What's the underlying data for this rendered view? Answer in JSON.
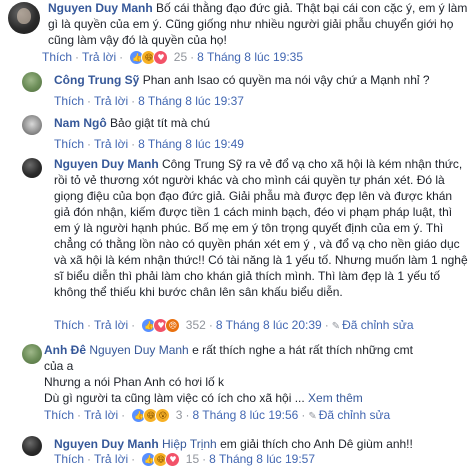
{
  "labels": {
    "reply": "Thích",
    "answer": "Trả lời",
    "edit_label": "Đã chỉnh sửa",
    "see_more": "Xem thêm",
    "sep": "·"
  },
  "comments": [
    {
      "author": "Nguyen Duy Manh",
      "text_first": "Bố cái thằng đạo đức giả. Thật bại cái con cặc ý, em",
      "text_rest": "ý làm gì là quyền của em ý. Cũng giống như nhiều người giải phẫu chuyển giới họ cũng làm vậy đó là quyền của họ!",
      "count": "25",
      "time": "8 Tháng 8 lúc 19:35"
    },
    {
      "author": "Công Trung Sỹ",
      "text_first": "Phan anh lsao có quyền ma nói vậy chứ a Mạnh nhỉ ?",
      "time": "8 Tháng 8 lúc 19:37"
    },
    {
      "author": "Nam Ngô",
      "text_first": "Bảo giật tít mà chú",
      "time": "8 Tháng 8 lúc 19:49"
    },
    {
      "author": "Nguyen Duy Manh",
      "text_first": "Công Trung Sỹ ra vẻ đổ vạ cho xã hội là kém nhận",
      "text_rest": "thức, rồi tỏ vẻ thương xót người khác và cho mình cái quyền tự phán xét. Đó là giọng điệu của bọn đạo đức giả. Giải phẫu mà được đẹp lên và được khán giả đón nhận, kiếm được tiền 1 cách minh bạch, đéo vi phạm pháp luật, thì em ý là người hạnh phúc. Bố mẹ em ý tôn trọng quyết định của em ý. Thì chẳng có thằng lồn nào có quyền phán xét em ý , và đổ vạ cho nền giáo dục và xã hội là kém nhận thức!! Có tài năng là 1 yếu tố. Nhưng muốn làm 1 nghệ sĩ biểu diễn thì phải làm cho khán giả thích mình. Thì làm đẹp là 1 yếu tố không thể thiếu khi bước chân lên sân khấu biểu diễn.",
      "count": "352",
      "time": "8 Tháng 8 lúc 20:39"
    },
    {
      "author": "Anh Đê",
      "mention": "Nguyen Duy Manh",
      "text_first": "e rất thích nghe a hát rất thích những cmt",
      "text_line2": "của a",
      "text_line3": "Nhưng a nói Phan Anh có hơi lố k",
      "text_line4": "Dù gì người ta cũng làm việc có ích cho xã hội ...",
      "count": "3",
      "time": "8 Tháng 8 lúc 19:56"
    },
    {
      "author": "Nguyen Duy Manh",
      "mention": "Hiệp Trịnh",
      "text_first": "em giải thích cho Anh Dê giùm anh!!",
      "count": "15",
      "time": "8 Tháng 8 lúc 19:57"
    }
  ]
}
